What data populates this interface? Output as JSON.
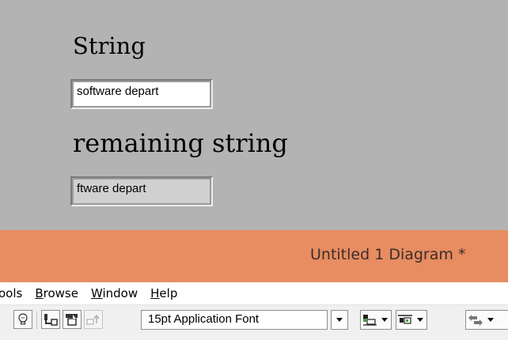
{
  "front_panel": {
    "string_label": "String",
    "string_value": "software depart",
    "remaining_label": "remaining string",
    "remaining_value": "ftware depart"
  },
  "window": {
    "title": "Untitled 1 Diagram *"
  },
  "menu": {
    "items": [
      {
        "pre": "",
        "key": "",
        "post": "ools"
      },
      {
        "pre": "",
        "key": "B",
        "post": "rowse"
      },
      {
        "pre": "",
        "key": "W",
        "post": "indow"
      },
      {
        "pre": "",
        "key": "H",
        "post": "elp"
      }
    ]
  },
  "toolbar": {
    "font": "15pt Application Font",
    "icons": [
      "highlight-execution-icon",
      "retain-wire-values-icon",
      "step-into-icon",
      "step-out-icon",
      "font-dropdown-icon",
      "align-objects-icon",
      "distribute-objects-icon",
      "reorder-icon"
    ]
  },
  "colors": {
    "panel_bg": "#b3b3b3",
    "title_bar": "#e88c61",
    "menu_bg": "#ffffff",
    "toolbar_bg": "#f0f0f0"
  }
}
